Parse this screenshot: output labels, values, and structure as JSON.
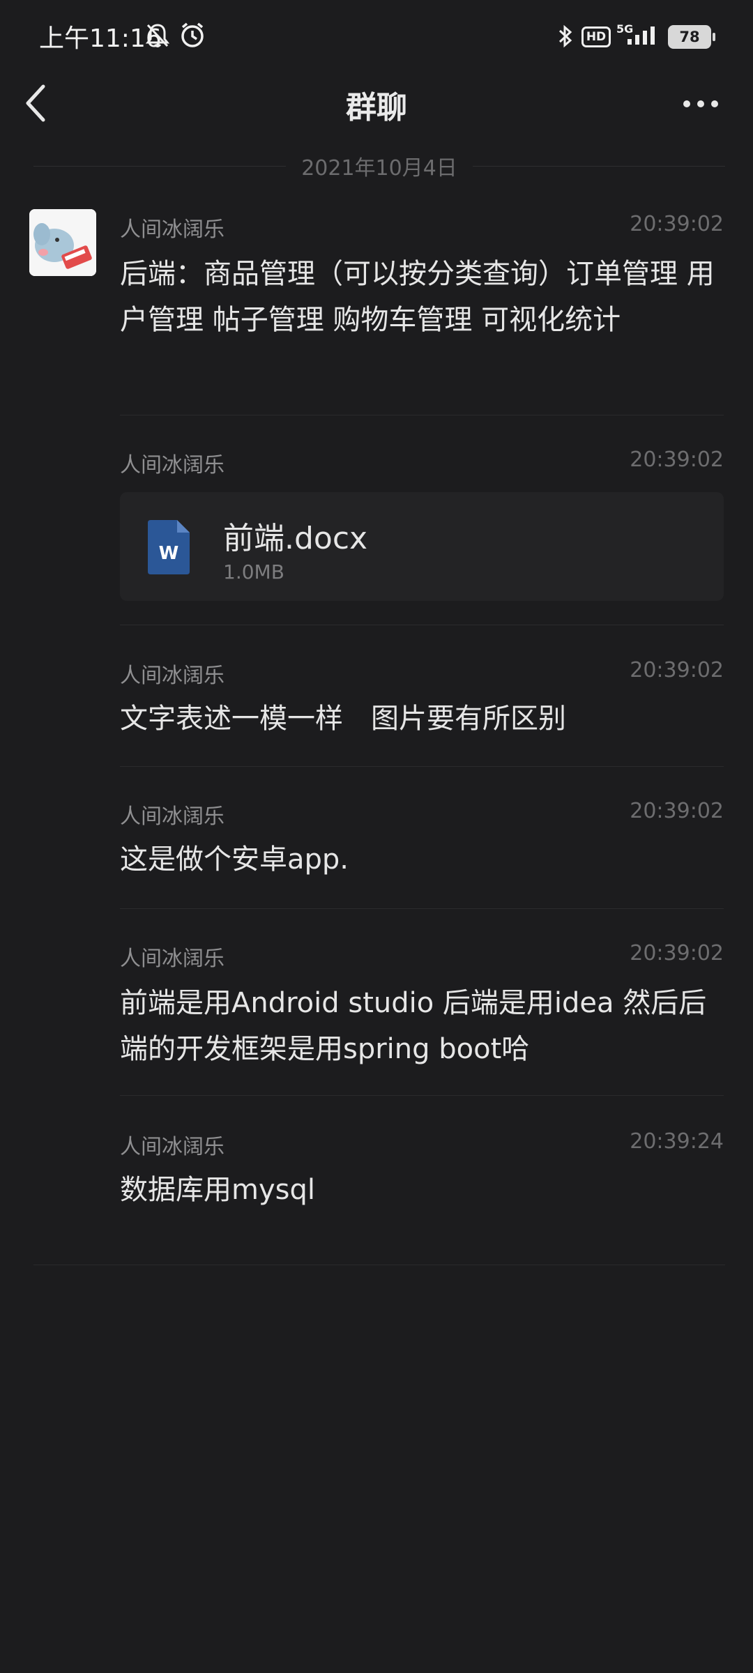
{
  "status_bar": {
    "time": "上午11:16",
    "network": "5G",
    "hd": "HD",
    "battery": "78"
  },
  "header": {
    "title": "群聊"
  },
  "date_separator": "2021年10月4日",
  "messages": [
    {
      "sender": "人间冰阔乐",
      "time": "20:39:02",
      "text": "后端：商品管理（可以按分类查询）订单管理 用户管理 帖子管理 购物车管理 可视化统计"
    },
    {
      "sender": "人间冰阔乐",
      "time": "20:39:02",
      "file": {
        "name": "前端.docx",
        "size": "1.0MB",
        "icon": "word-doc-icon",
        "icon_letter": "W"
      }
    },
    {
      "sender": "人间冰阔乐",
      "time": "20:39:02",
      "text": "文字表述一模一样　图片要有所区别"
    },
    {
      "sender": "人间冰阔乐",
      "time": "20:39:02",
      "text": "这是做个安卓app."
    },
    {
      "sender": "人间冰阔乐",
      "time": "20:39:02",
      "text": "前端是用Android studio 后端是用idea 然后后端的开发框架是用spring boot哈"
    },
    {
      "sender": "人间冰阔乐",
      "time": "20:39:24",
      "text": "数据库用mysql"
    }
  ],
  "colors": {
    "background": "#1c1c1e",
    "text": "#e6e6e6",
    "muted": "#8f8f91",
    "word_blue": "#2b5797"
  }
}
